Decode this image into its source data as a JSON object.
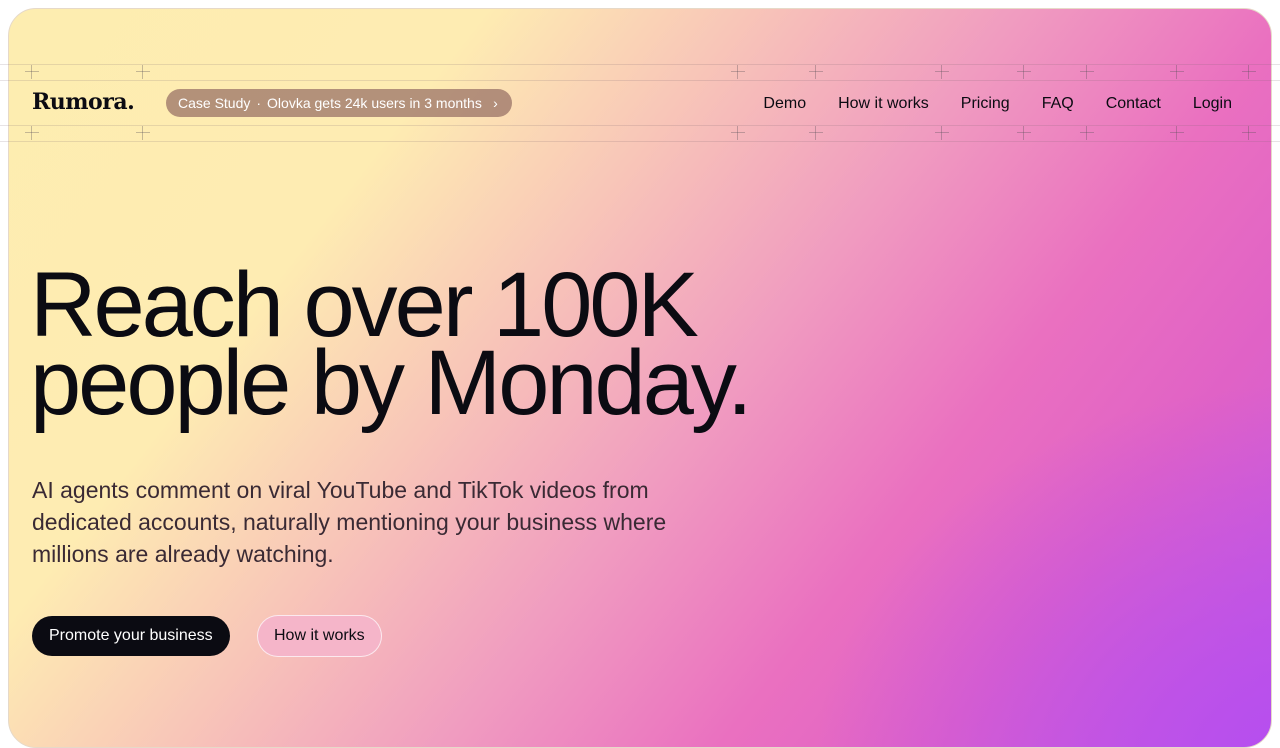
{
  "brand": {
    "logo_text": "Rumora."
  },
  "announcement": {
    "tag": "Case Study",
    "separator": "·",
    "text": "Olovka gets 24k users in 3 months",
    "chevron": "›"
  },
  "nav": {
    "items": [
      {
        "label": "Demo"
      },
      {
        "label": "How it works"
      },
      {
        "label": "Pricing"
      },
      {
        "label": "FAQ"
      },
      {
        "label": "Contact"
      },
      {
        "label": "Login"
      }
    ]
  },
  "hero": {
    "headline_line1": "Reach over 100K",
    "headline_line2": "people by Monday.",
    "subheadline": "AI agents comment on viral YouTube and TikTok videos from dedicated accounts, naturally mentioning your business where millions are already watching.",
    "primary_cta": "Promote your business",
    "secondary_cta": "How it works"
  },
  "colors": {
    "text": "#0b0b12",
    "primary_button": "#0b0b12",
    "secondary_button": "#f5b5c9",
    "gradient_start": "#fdedb0",
    "gradient_mid": "#ea70c0",
    "gradient_end": "#b44df0"
  }
}
